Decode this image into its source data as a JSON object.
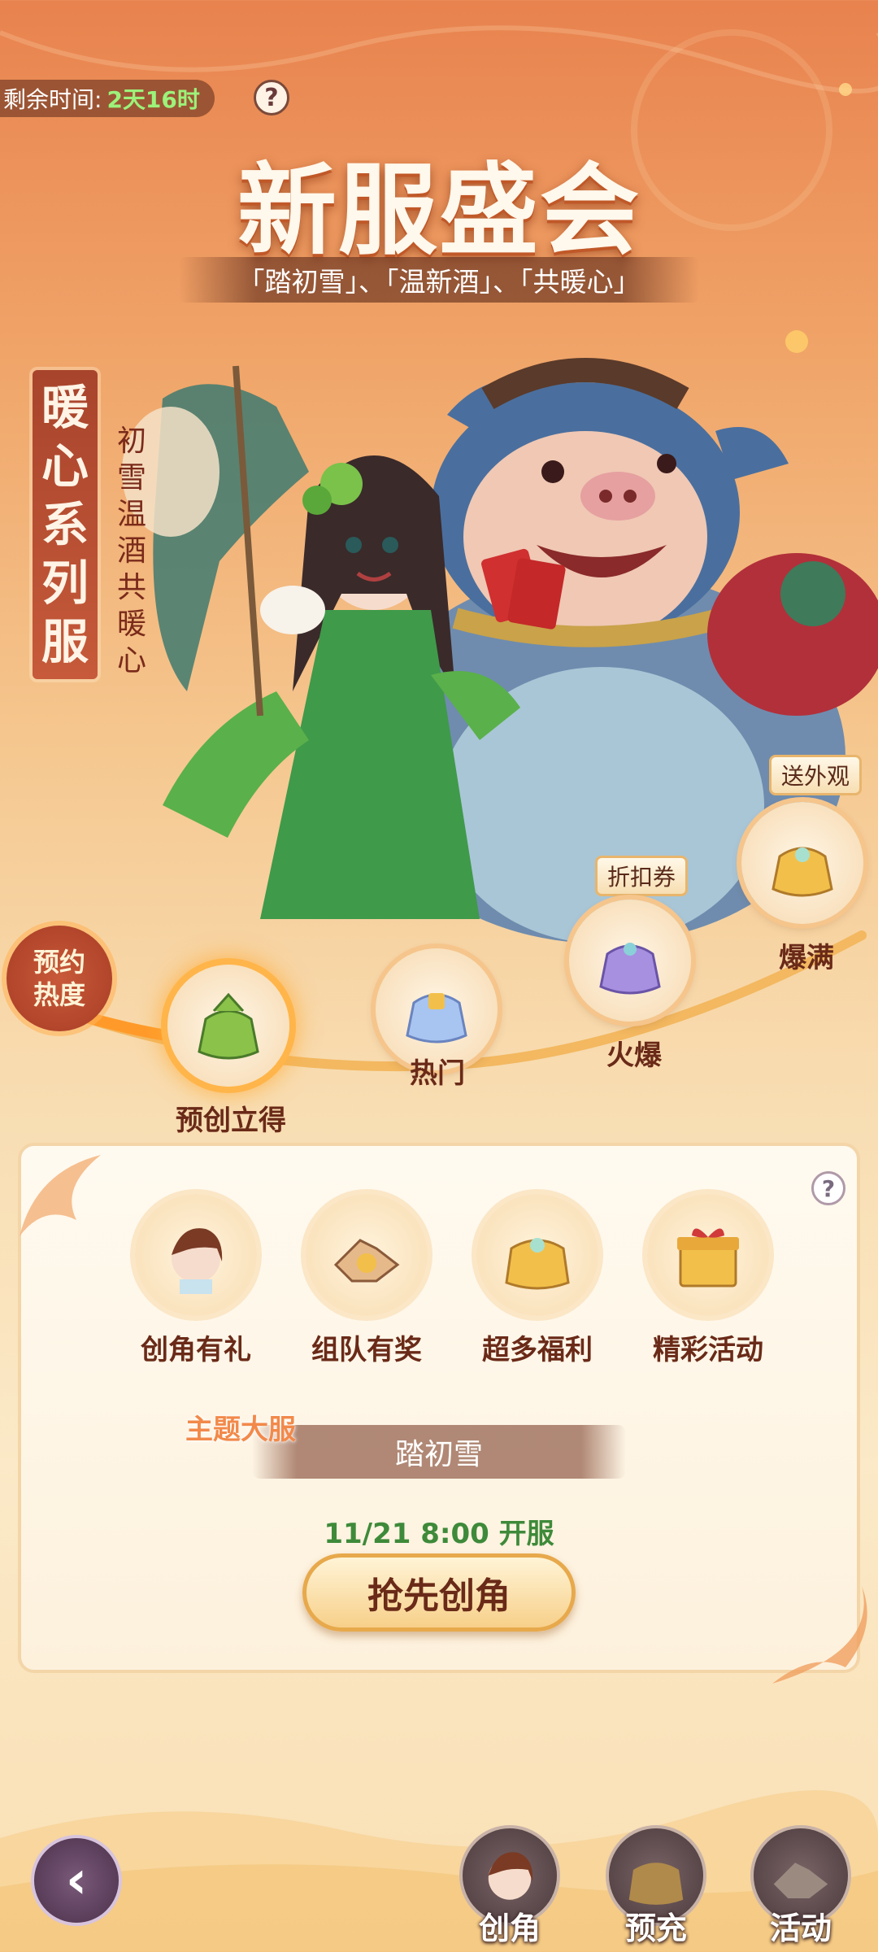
{
  "header": {
    "timer_label": "剩余时间:",
    "timer_value": "2天16时",
    "help_symbol": "?",
    "title": "新服盛会",
    "subtitle": "「踏初雪」、「温新酒」、「共暖心」"
  },
  "side": {
    "banner": "暖心系列服",
    "poem": "初雪温酒共暖心"
  },
  "tiers": {
    "heat_label_1": "预约",
    "heat_label_2": "热度",
    "items": [
      {
        "label": "预创立得",
        "active": true,
        "tag": ""
      },
      {
        "label": "热门",
        "active": false,
        "tag": ""
      },
      {
        "label": "火爆",
        "active": false,
        "tag": "折扣券"
      },
      {
        "label": "爆满",
        "active": false,
        "tag": "送外观"
      }
    ]
  },
  "panel": {
    "help_symbol": "?",
    "features": [
      {
        "label": "创角有礼",
        "icon": "character-icon"
      },
      {
        "label": "组队有奖",
        "icon": "handshake-icon"
      },
      {
        "label": "超多福利",
        "icon": "gold-bag-icon"
      },
      {
        "label": "精彩活动",
        "icon": "gift-box-icon"
      }
    ],
    "theme_label": "主题大服",
    "server_name": "踏初雪",
    "open_time": "11/21 8:00 开服",
    "cta_label": "抢先创角"
  },
  "bottom_nav": {
    "back_symbol": "‹",
    "items": [
      {
        "label": "创角",
        "icon": "character-icon"
      },
      {
        "label": "预充",
        "icon": "gold-bag-icon"
      },
      {
        "label": "活动",
        "icon": "handshake-icon"
      }
    ]
  },
  "colors": {
    "accent": "#6a2a18",
    "timer_value": "#9cf27a",
    "open_time": "#3e8a3a",
    "theme_label": "#f2894a"
  }
}
